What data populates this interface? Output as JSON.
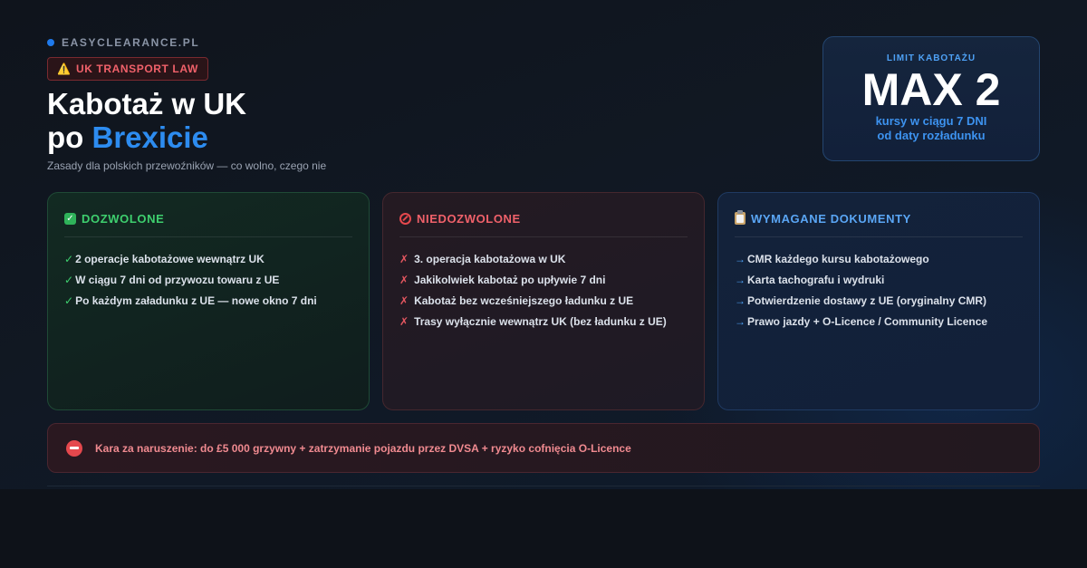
{
  "brand": {
    "name": "EASYCLEARANCE.PL",
    "accent_color": "#1f7aec"
  },
  "badge": {
    "icon": "warning-icon",
    "glyph": "⚠️",
    "label": "UK TRANSPORT LAW"
  },
  "header": {
    "title_line1": "Kabotaż w UK",
    "title_line2_prefix": "po ",
    "title_line2_accent": "Brexicie",
    "subtitle": "Zasady dla polskich przewoźników — co wolno, czego nie"
  },
  "limit": {
    "label": "LIMIT KABOTAŻU",
    "value": "MAX 2",
    "note_line1": "kursy w ciągu 7 DNI",
    "note_line2": "od daty rozładunku"
  },
  "cards": {
    "allowed": {
      "icon": "check-mark-icon",
      "title": "DOZWOLONE",
      "color": "#3ecf6e",
      "items": [
        {
          "mark": "✓",
          "text": "2 operacje kabotażowe wewnątrz UK"
        },
        {
          "mark": "✓",
          "text": "W ciągu 7 dni od przywozu towaru z UE"
        },
        {
          "mark": "✓",
          "text": "Po każdym załadunku z UE — nowe okno 7 dni"
        }
      ]
    },
    "forbidden": {
      "icon": "prohibited-icon",
      "title": "NIEDOZWOLONE",
      "color": "#f0616a",
      "items": [
        {
          "mark": "✗",
          "text": "3. operacja kabotażowa w UK"
        },
        {
          "mark": "✗",
          "text": "Jakikolwiek kabotaż po upływie 7 dni"
        },
        {
          "mark": "✗",
          "text": "Kabotaż bez wcześniejszego ładunku z UE"
        },
        {
          "mark": "✗",
          "text": "Trasy wyłącznie wewnątrz UK (bez ładunku z UE)"
        }
      ]
    },
    "documents": {
      "icon": "clipboard-icon",
      "title": "WYMAGANE DOKUMENTY",
      "color": "#5aa6f5",
      "items": [
        {
          "mark": "→",
          "text": "CMR każdego kursu kabotażowego"
        },
        {
          "mark": "→",
          "text": "Karta tachografu i wydruki"
        },
        {
          "mark": "→",
          "text": "Potwierdzenie dostawy z UE (oryginalny CMR)"
        },
        {
          "mark": "→",
          "text": "Prawo jazdy + O-Licence / Community Licence"
        }
      ]
    }
  },
  "penalty": {
    "icon": "no-entry-icon",
    "text": "Kara za naruszenie: do £5 000 grzywny + zatrzymanie pojazdu przez DVSA + ryzyko cofnięcia O-Licence"
  }
}
